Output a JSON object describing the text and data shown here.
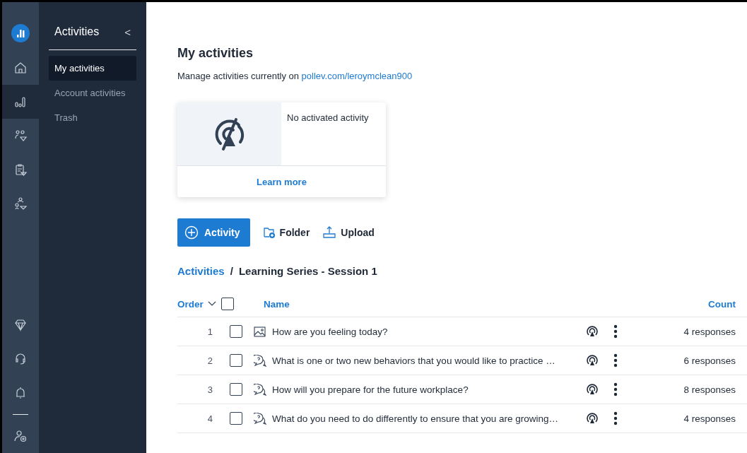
{
  "rail": {
    "top": [
      {
        "selected": false
      },
      {
        "selected": true
      },
      {
        "selected": false
      },
      {
        "selected": false
      },
      {
        "selected": false
      }
    ]
  },
  "nav": {
    "title": "Activities",
    "collapse": "<",
    "items": [
      {
        "label": "My activities",
        "selected": true
      },
      {
        "label": "Account activities",
        "selected": false
      },
      {
        "label": "Trash",
        "selected": false
      }
    ]
  },
  "page": {
    "title": "My activities",
    "subtitle": "Manage activities currently on",
    "link": "pollev.com/leroymclean900"
  },
  "card": {
    "message": "No activated activity",
    "action": "Learn more"
  },
  "toolbar": [
    {
      "label": "Activity",
      "kind": "primary"
    },
    {
      "label": "Folder",
      "kind": "folder"
    },
    {
      "label": "Upload",
      "kind": "upload"
    }
  ],
  "breadcrumb": {
    "parent": "Activities",
    "separator": "/",
    "current": "Learning Series - Session 1"
  },
  "table": {
    "columns": {
      "order": "Order",
      "name": "Name",
      "count": "Count"
    },
    "all_checked": false,
    "rows": [
      {
        "order": "1",
        "checked": false,
        "kind": "image",
        "name": "How are you feeling today?",
        "count": "4 responses"
      },
      {
        "order": "2",
        "checked": false,
        "kind": "question",
        "name": "What is one or two new behaviors that you would like to practice …",
        "count": "6 responses"
      },
      {
        "order": "3",
        "checked": false,
        "kind": "question",
        "name": "How will you prepare for the future workplace?",
        "count": "8 responses"
      },
      {
        "order": "4",
        "checked": false,
        "kind": "question",
        "name": "What do you need to do differently to ensure that you are growing…",
        "count": "4 responses"
      }
    ]
  }
}
